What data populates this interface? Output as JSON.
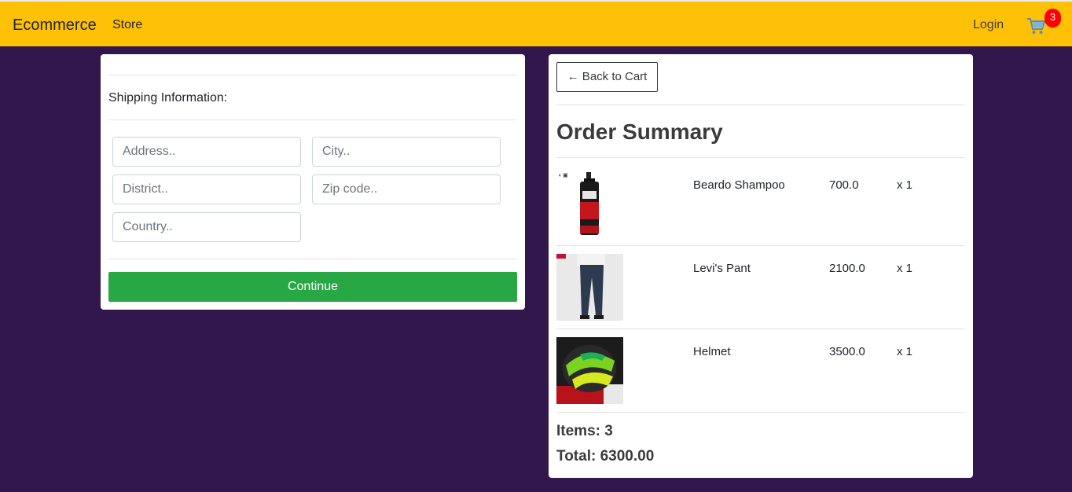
{
  "navbar": {
    "brand": "Ecommerce",
    "store_label": "Store",
    "login_label": "Login",
    "cart_count": "3",
    "cart_icon": "shopping-cart-icon",
    "colors": {
      "background": "#ffc107",
      "badge": "#ff0000"
    }
  },
  "page": {
    "background": "#32174d"
  },
  "shipping": {
    "title": "Shipping Information:",
    "fields": {
      "address": "Address..",
      "city": "City..",
      "district": "District..",
      "zip": "Zip code..",
      "country": "Country.."
    },
    "continue_label": "Continue",
    "continue_color": "#28a745"
  },
  "summary": {
    "back_label": "← Back to Cart",
    "title": "Order Summary",
    "items": [
      {
        "name": "Beardo Shampoo",
        "price": "700.0",
        "qty": "x 1"
      },
      {
        "name": "Levi's Pant",
        "price": "2100.0",
        "qty": "x 1"
      },
      {
        "name": "Helmet",
        "price": "3500.0",
        "qty": "x 1"
      }
    ],
    "items_total": "Items: 3",
    "total": "Total: 6300.00"
  }
}
